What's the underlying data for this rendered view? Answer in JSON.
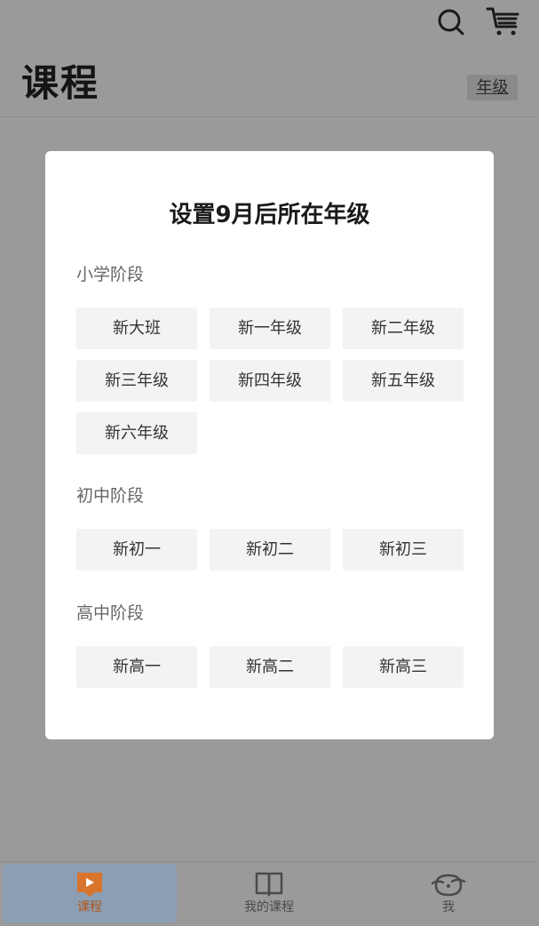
{
  "header": {
    "title": "课程",
    "grade_chip": "年级"
  },
  "modal": {
    "title": "设置9月后所在年级",
    "sections": [
      {
        "label": "小学阶段",
        "grades": [
          "新大班",
          "新一年级",
          "新二年级",
          "新三年级",
          "新四年级",
          "新五年级",
          "新六年级"
        ]
      },
      {
        "label": "初中阶段",
        "grades": [
          "新初一",
          "新初二",
          "新初三"
        ]
      },
      {
        "label": "高中阶段",
        "grades": [
          "新高一",
          "新高二",
          "新高三"
        ]
      }
    ]
  },
  "bottom_nav": {
    "items": [
      {
        "label": "课程",
        "icon": "play-square-icon",
        "active": true
      },
      {
        "label": "我的课程",
        "icon": "open-book-icon",
        "active": false
      },
      {
        "label": "我",
        "icon": "face-icon",
        "active": false
      }
    ]
  },
  "colors": {
    "overlay": "#9a9a9a",
    "accent": "#d9742c",
    "active_tab_bg": "#8b9eb3",
    "button_bg": "#f3f3f3"
  }
}
